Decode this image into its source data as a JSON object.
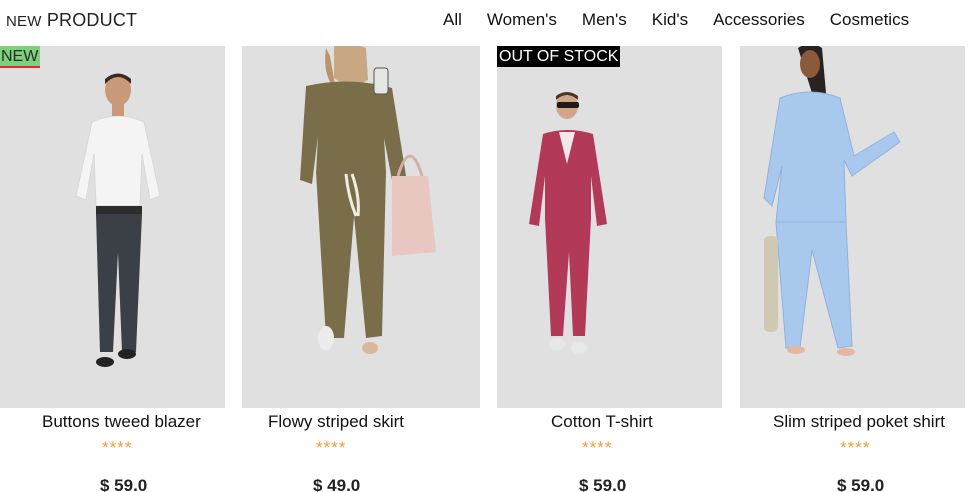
{
  "header": {
    "logo_prefix": "NEW",
    "logo_main": "PRODUCT",
    "nav": [
      "All",
      "Women's",
      "Men's",
      "Kid's",
      "Accessories",
      "Cosmetics"
    ]
  },
  "products": [
    {
      "name": "Buttons tweed blazer",
      "rating": "****",
      "price": "$ 59.0",
      "badge": "NEW",
      "image": "man-white-shirt-dark-jeans"
    },
    {
      "name": "Flowy striped skirt",
      "rating": "****",
      "price": "$ 49.0",
      "badge": "",
      "image": "woman-olive-loungewear-with-coffee-and-tote"
    },
    {
      "name": "Cotton T-shirt",
      "rating": "****",
      "price": "$ 59.0",
      "badge": "OUT OF STOCK",
      "image": "man-burgundy-suit-sunglasses"
    },
    {
      "name": "Slim striped poket shirt",
      "rating": "****",
      "price": "$ 59.0",
      "badge": "",
      "image": "woman-light-blue-satin-jumpsuit"
    }
  ],
  "colors": {
    "image_bg": "#e0e0e0",
    "star": "#f0a030",
    "new_badge": "#7dd17d",
    "new_underline": "#e0283a",
    "oos_badge": "#000000"
  }
}
